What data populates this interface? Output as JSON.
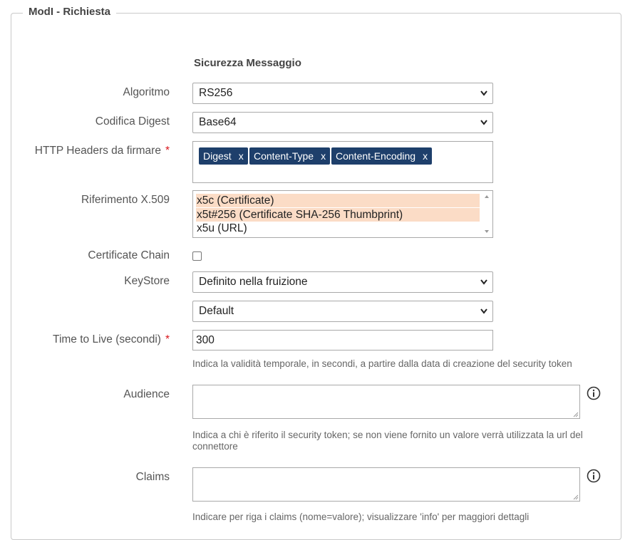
{
  "fieldset": {
    "legend": "ModI - Richiesta"
  },
  "section": {
    "title": "Sicurezza Messaggio"
  },
  "fields": {
    "algoritmo": {
      "label": "Algoritmo",
      "value": "RS256"
    },
    "codifica_digest": {
      "label": "Codifica Digest",
      "value": "Base64"
    },
    "http_headers": {
      "label": "HTTP Headers da firmare",
      "required_mark": "*",
      "tags": [
        {
          "text": "Digest",
          "remove": "x"
        },
        {
          "text": "Content-Type",
          "remove": "x"
        },
        {
          "text": "Content-Encoding",
          "remove": "x"
        }
      ]
    },
    "riferimento_x509": {
      "label": "Riferimento X.509",
      "options": [
        {
          "text": "x5c (Certificate)",
          "selected": true
        },
        {
          "text": "x5t#256 (Certificate SHA-256 Thumbprint)",
          "selected": true
        },
        {
          "text": "x5u (URL)",
          "selected": false
        }
      ]
    },
    "certificate_chain": {
      "label": "Certificate Chain",
      "checked": false
    },
    "keystore": {
      "label": "KeyStore",
      "value": "Definito nella fruizione",
      "value2": "Default"
    },
    "time_to_live": {
      "label": "Time to Live (secondi)",
      "required_mark": "*",
      "value": "300",
      "help": "Indica la validità temporale, in secondi, a partire dalla data di creazione del security token"
    },
    "audience": {
      "label": "Audience",
      "value": "",
      "help": "Indica a chi è riferito il security token; se non viene fornito un valore verrà utilizzata la url del connettore"
    },
    "claims": {
      "label": "Claims",
      "value": "",
      "help": "Indicare per riga i claims (nome=valore); visualizzare 'info' per maggiori dettagli"
    }
  },
  "icons": {
    "select_arrow": "chevron-down-icon",
    "info": "info-icon"
  },
  "colors": {
    "tag_bg": "#1e3f6b",
    "selected_option_bg": "#fbdcc6",
    "required": "#d9151b"
  }
}
